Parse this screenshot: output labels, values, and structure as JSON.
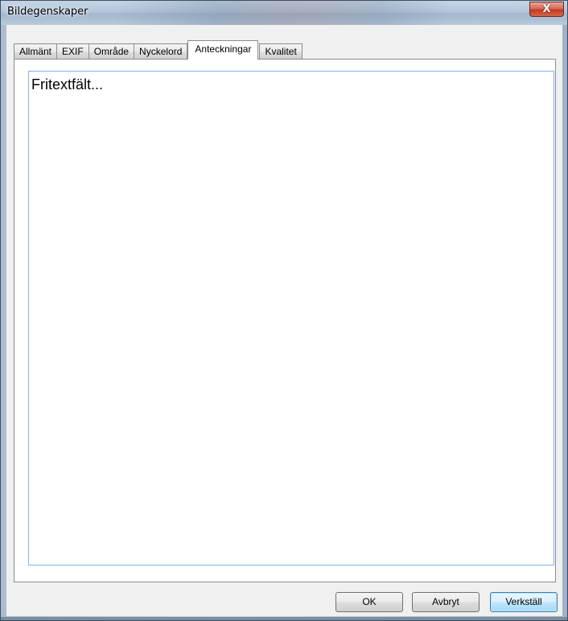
{
  "window": {
    "title": "Bildegenskaper",
    "close_symbol": "X"
  },
  "tabs": [
    {
      "label": "Allmänt",
      "active": false
    },
    {
      "label": "EXIF",
      "active": false
    },
    {
      "label": "Område",
      "active": false
    },
    {
      "label": "Nyckelord",
      "active": false
    },
    {
      "label": "Anteckningar",
      "active": true
    },
    {
      "label": "Kvalitet",
      "active": false
    }
  ],
  "notes": {
    "value": "Fritextfält..."
  },
  "buttons": {
    "ok": "OK",
    "cancel": "Avbryt",
    "apply": "Verkställ"
  }
}
